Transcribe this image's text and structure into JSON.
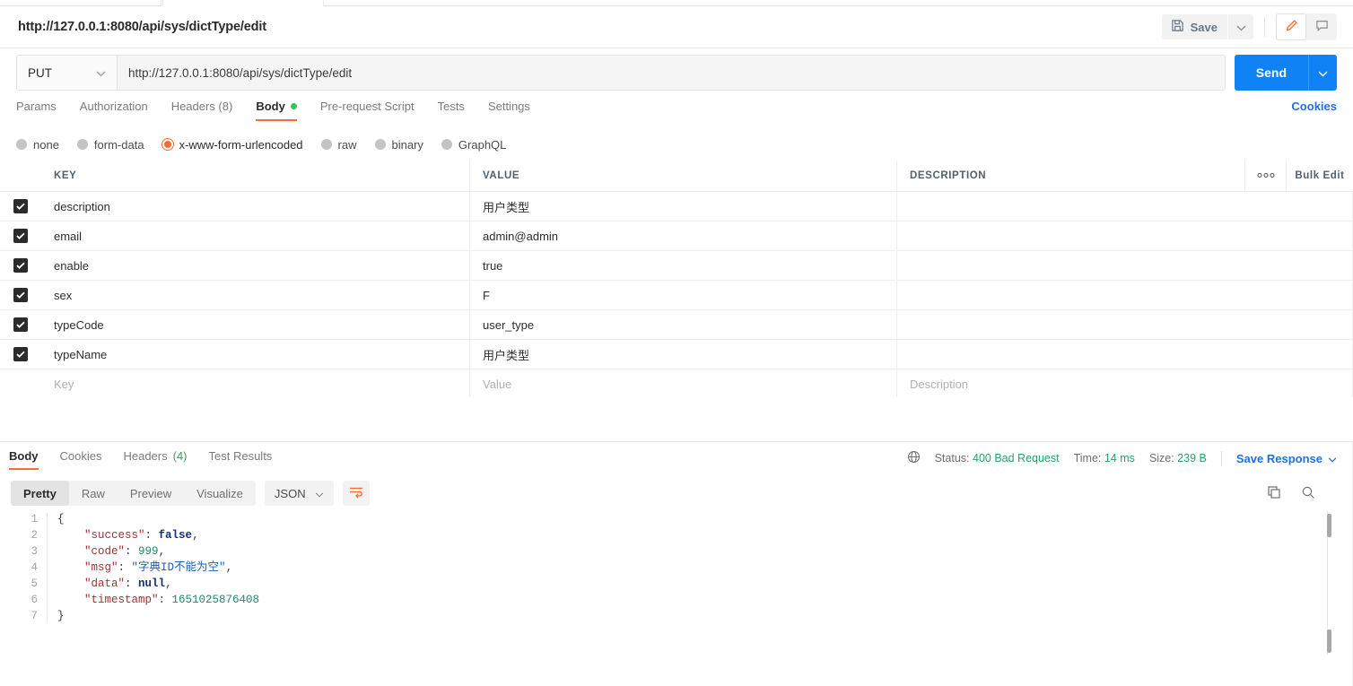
{
  "request": {
    "title": "http://127.0.0.1:8080/api/sys/dictType/edit",
    "save_label": "Save",
    "method": "PUT",
    "url": "http://127.0.0.1:8080/api/sys/dictType/edit",
    "send_label": "Send",
    "cookies_label": "Cookies",
    "tabs": [
      {
        "label": "Params",
        "active": false
      },
      {
        "label": "Authorization",
        "active": false
      },
      {
        "label": "Headers (8)",
        "active": false
      },
      {
        "label": "Body",
        "active": true
      },
      {
        "label": "Pre-request Script",
        "active": false
      },
      {
        "label": "Tests",
        "active": false
      },
      {
        "label": "Settings",
        "active": false
      }
    ],
    "body_types": [
      {
        "label": "none",
        "selected": false
      },
      {
        "label": "form-data",
        "selected": false
      },
      {
        "label": "x-www-form-urlencoded",
        "selected": true
      },
      {
        "label": "raw",
        "selected": false
      },
      {
        "label": "binary",
        "selected": false
      },
      {
        "label": "GraphQL",
        "selected": false
      }
    ]
  },
  "table": {
    "headers": {
      "key": "KEY",
      "value": "VALUE",
      "description": "DESCRIPTION"
    },
    "bulk_edit_label": "Bulk Edit",
    "more_icon": "ellipsis-icon",
    "rows": [
      {
        "checked": true,
        "key": "description",
        "value": "用户类型",
        "description": ""
      },
      {
        "checked": true,
        "key": "email",
        "value": "admin@admin",
        "description": ""
      },
      {
        "checked": true,
        "key": "enable",
        "value": "true",
        "description": ""
      },
      {
        "checked": true,
        "key": "sex",
        "value": "F",
        "description": ""
      },
      {
        "checked": true,
        "key": "typeCode",
        "value": "user_type",
        "description": ""
      },
      {
        "checked": true,
        "key": "typeName",
        "value": "用户类型",
        "description": ""
      }
    ],
    "placeholder_row": {
      "key": "Key",
      "value": "Value",
      "description": "Description"
    }
  },
  "response": {
    "tabs": [
      {
        "label": "Body",
        "active": true,
        "suffix": ""
      },
      {
        "label": "Cookies",
        "active": false,
        "suffix": ""
      },
      {
        "label": "Headers",
        "active": false,
        "suffix": "(4)"
      },
      {
        "label": "Test Results",
        "active": false,
        "suffix": ""
      }
    ],
    "status_label": "Status:",
    "status_value": "400 Bad Request",
    "time_label": "Time:",
    "time_value": "14 ms",
    "size_label": "Size:",
    "size_value": "239 B",
    "save_response_label": "Save Response",
    "view_modes": [
      {
        "label": "Pretty",
        "active": true
      },
      {
        "label": "Raw",
        "active": false
      },
      {
        "label": "Preview",
        "active": false
      },
      {
        "label": "Visualize",
        "active": false
      }
    ],
    "format": "JSON",
    "body_lines": [
      {
        "num": "1",
        "tokens": [
          {
            "t": "{",
            "c": "brace"
          }
        ]
      },
      {
        "num": "2",
        "tokens": [
          {
            "t": "    ",
            "c": "p"
          },
          {
            "t": "\"success\"",
            "c": "k"
          },
          {
            "t": ": ",
            "c": "p"
          },
          {
            "t": "false",
            "c": "b"
          },
          {
            "t": ",",
            "c": "p"
          }
        ]
      },
      {
        "num": "3",
        "tokens": [
          {
            "t": "    ",
            "c": "p"
          },
          {
            "t": "\"code\"",
            "c": "k"
          },
          {
            "t": ": ",
            "c": "p"
          },
          {
            "t": "999",
            "c": "n"
          },
          {
            "t": ",",
            "c": "p"
          }
        ]
      },
      {
        "num": "4",
        "tokens": [
          {
            "t": "    ",
            "c": "p"
          },
          {
            "t": "\"msg\"",
            "c": "k"
          },
          {
            "t": ": ",
            "c": "p"
          },
          {
            "t": "\"字典ID不能为空\"",
            "c": "s"
          },
          {
            "t": ",",
            "c": "p"
          }
        ]
      },
      {
        "num": "5",
        "tokens": [
          {
            "t": "    ",
            "c": "p"
          },
          {
            "t": "\"data\"",
            "c": "k"
          },
          {
            "t": ": ",
            "c": "p"
          },
          {
            "t": "null",
            "c": "b"
          },
          {
            "t": ",",
            "c": "p"
          }
        ]
      },
      {
        "num": "6",
        "tokens": [
          {
            "t": "    ",
            "c": "p"
          },
          {
            "t": "\"timestamp\"",
            "c": "k"
          },
          {
            "t": ": ",
            "c": "p"
          },
          {
            "t": "1651025876408",
            "c": "n"
          }
        ]
      },
      {
        "num": "7",
        "tokens": [
          {
            "t": "}",
            "c": "brace"
          }
        ]
      }
    ],
    "copy_icon": "copy-icon",
    "search_icon": "search-icon"
  },
  "colors": {
    "accent_orange": "#fc6c30",
    "link_blue": "#1f6fe5",
    "send_blue": "#0f82f5",
    "status_green": "#2aa06a"
  }
}
